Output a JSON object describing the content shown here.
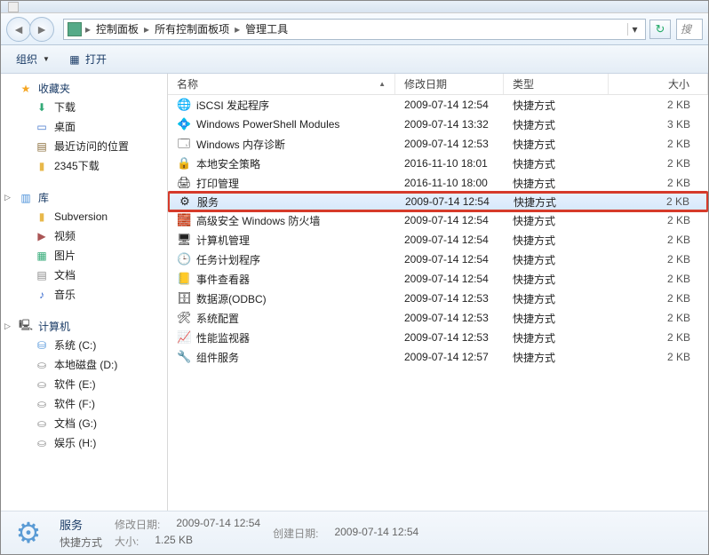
{
  "breadcrumbs": [
    "控制面板",
    "所有控制面板项",
    "管理工具"
  ],
  "search_placeholder": "搜",
  "toolbar": {
    "organize": "组织",
    "open": "打开"
  },
  "sidebar": {
    "favorites": {
      "label": "收藏夹",
      "items": [
        "下载",
        "桌面",
        "最近访问的位置",
        "2345下载"
      ]
    },
    "libraries": {
      "label": "库",
      "items": [
        "Subversion",
        "视频",
        "图片",
        "文档",
        "音乐"
      ]
    },
    "computer": {
      "label": "计算机",
      "items": [
        "系统 (C:)",
        "本地磁盘 (D:)",
        "软件 (E:)",
        "软件 (F:)",
        "文档 (G:)",
        "娱乐 (H:)"
      ]
    }
  },
  "columns": {
    "name": "名称",
    "date": "修改日期",
    "type": "类型",
    "size": "大小"
  },
  "files": [
    {
      "icon": "🌐",
      "name": "iSCSI 发起程序",
      "date": "2009-07-14 12:54",
      "type": "快捷方式",
      "size": "2 KB"
    },
    {
      "icon": "💠",
      "name": "Windows PowerShell Modules",
      "date": "2009-07-14 13:32",
      "type": "快捷方式",
      "size": "3 KB"
    },
    {
      "icon": "🗔",
      "name": "Windows 内存诊断",
      "date": "2009-07-14 12:53",
      "type": "快捷方式",
      "size": "2 KB"
    },
    {
      "icon": "🔒",
      "name": "本地安全策略",
      "date": "2016-11-10 18:01",
      "type": "快捷方式",
      "size": "2 KB"
    },
    {
      "icon": "🖨",
      "name": "打印管理",
      "date": "2016-11-10 18:00",
      "type": "快捷方式",
      "size": "2 KB"
    },
    {
      "icon": "⚙",
      "name": "服务",
      "date": "2009-07-14 12:54",
      "type": "快捷方式",
      "size": "2 KB",
      "selected": true,
      "highlighted": true
    },
    {
      "icon": "🧱",
      "name": "高级安全 Windows 防火墙",
      "date": "2009-07-14 12:54",
      "type": "快捷方式",
      "size": "2 KB"
    },
    {
      "icon": "🖥",
      "name": "计算机管理",
      "date": "2009-07-14 12:54",
      "type": "快捷方式",
      "size": "2 KB"
    },
    {
      "icon": "🕒",
      "name": "任务计划程序",
      "date": "2009-07-14 12:54",
      "type": "快捷方式",
      "size": "2 KB"
    },
    {
      "icon": "📒",
      "name": "事件查看器",
      "date": "2009-07-14 12:54",
      "type": "快捷方式",
      "size": "2 KB"
    },
    {
      "icon": "🗄",
      "name": "数据源(ODBC)",
      "date": "2009-07-14 12:53",
      "type": "快捷方式",
      "size": "2 KB"
    },
    {
      "icon": "🛠",
      "name": "系统配置",
      "date": "2009-07-14 12:53",
      "type": "快捷方式",
      "size": "2 KB"
    },
    {
      "icon": "📈",
      "name": "性能监视器",
      "date": "2009-07-14 12:53",
      "type": "快捷方式",
      "size": "2 KB"
    },
    {
      "icon": "🔧",
      "name": "组件服务",
      "date": "2009-07-14 12:57",
      "type": "快捷方式",
      "size": "2 KB"
    }
  ],
  "details": {
    "name": "服务",
    "type": "快捷方式",
    "mod_label": "修改日期:",
    "mod_value": "2009-07-14 12:54",
    "create_label": "创建日期:",
    "create_value": "2009-07-14 12:54",
    "size_label": "大小:",
    "size_value": "1.25 KB"
  }
}
